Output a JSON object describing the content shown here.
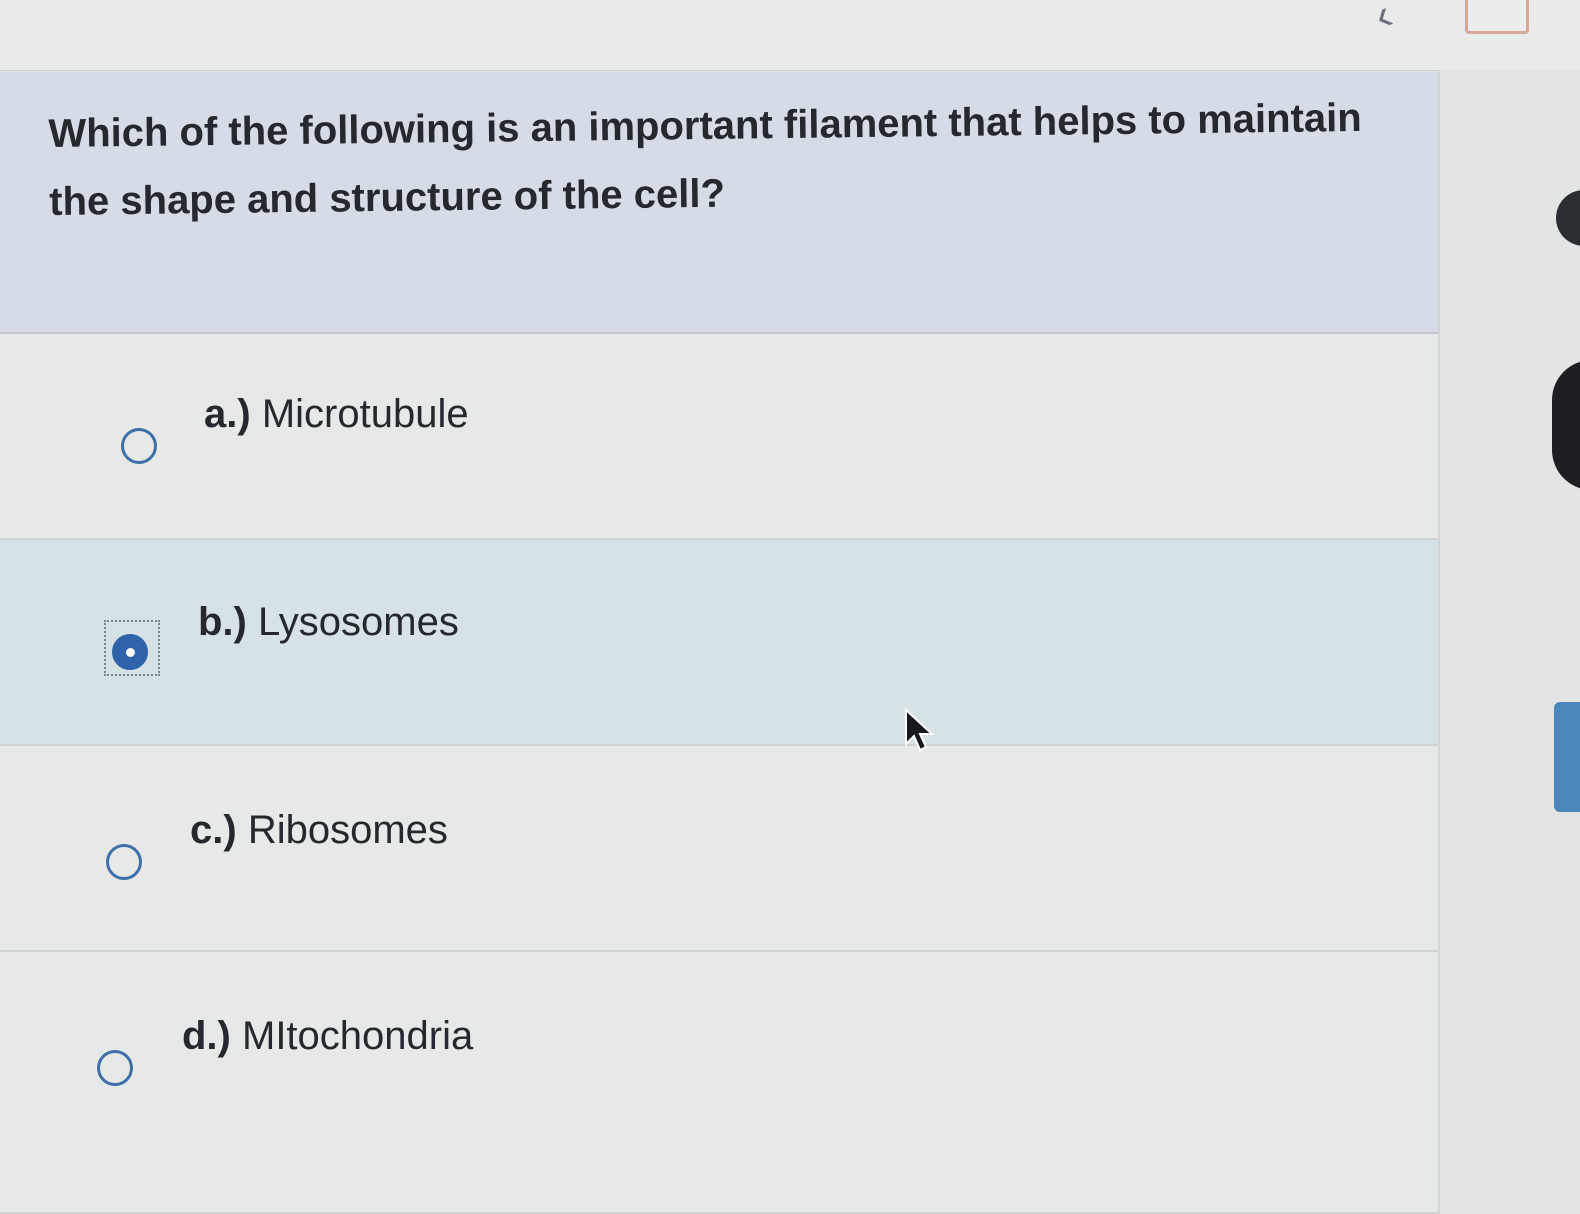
{
  "question": {
    "text": "Which of the following is an important filament that helps to maintain the shape and structure of the cell?"
  },
  "answers": [
    {
      "letter": "a.)",
      "label": "Microtubule",
      "selected": false
    },
    {
      "letter": "b.)",
      "label": "Lysosomes",
      "selected": true
    },
    {
      "letter": "c.)",
      "label": "Ribosomes",
      "selected": false
    },
    {
      "letter": "d.)",
      "label": "MItochondria",
      "selected": false
    }
  ],
  "colors": {
    "radio": "#3f6fa8",
    "selected_row": "#d6e2e5",
    "question_panel": "#d6dce6"
  },
  "icons": {
    "cursor": "arrow-cursor-icon",
    "radio": "radio-button-icon"
  }
}
